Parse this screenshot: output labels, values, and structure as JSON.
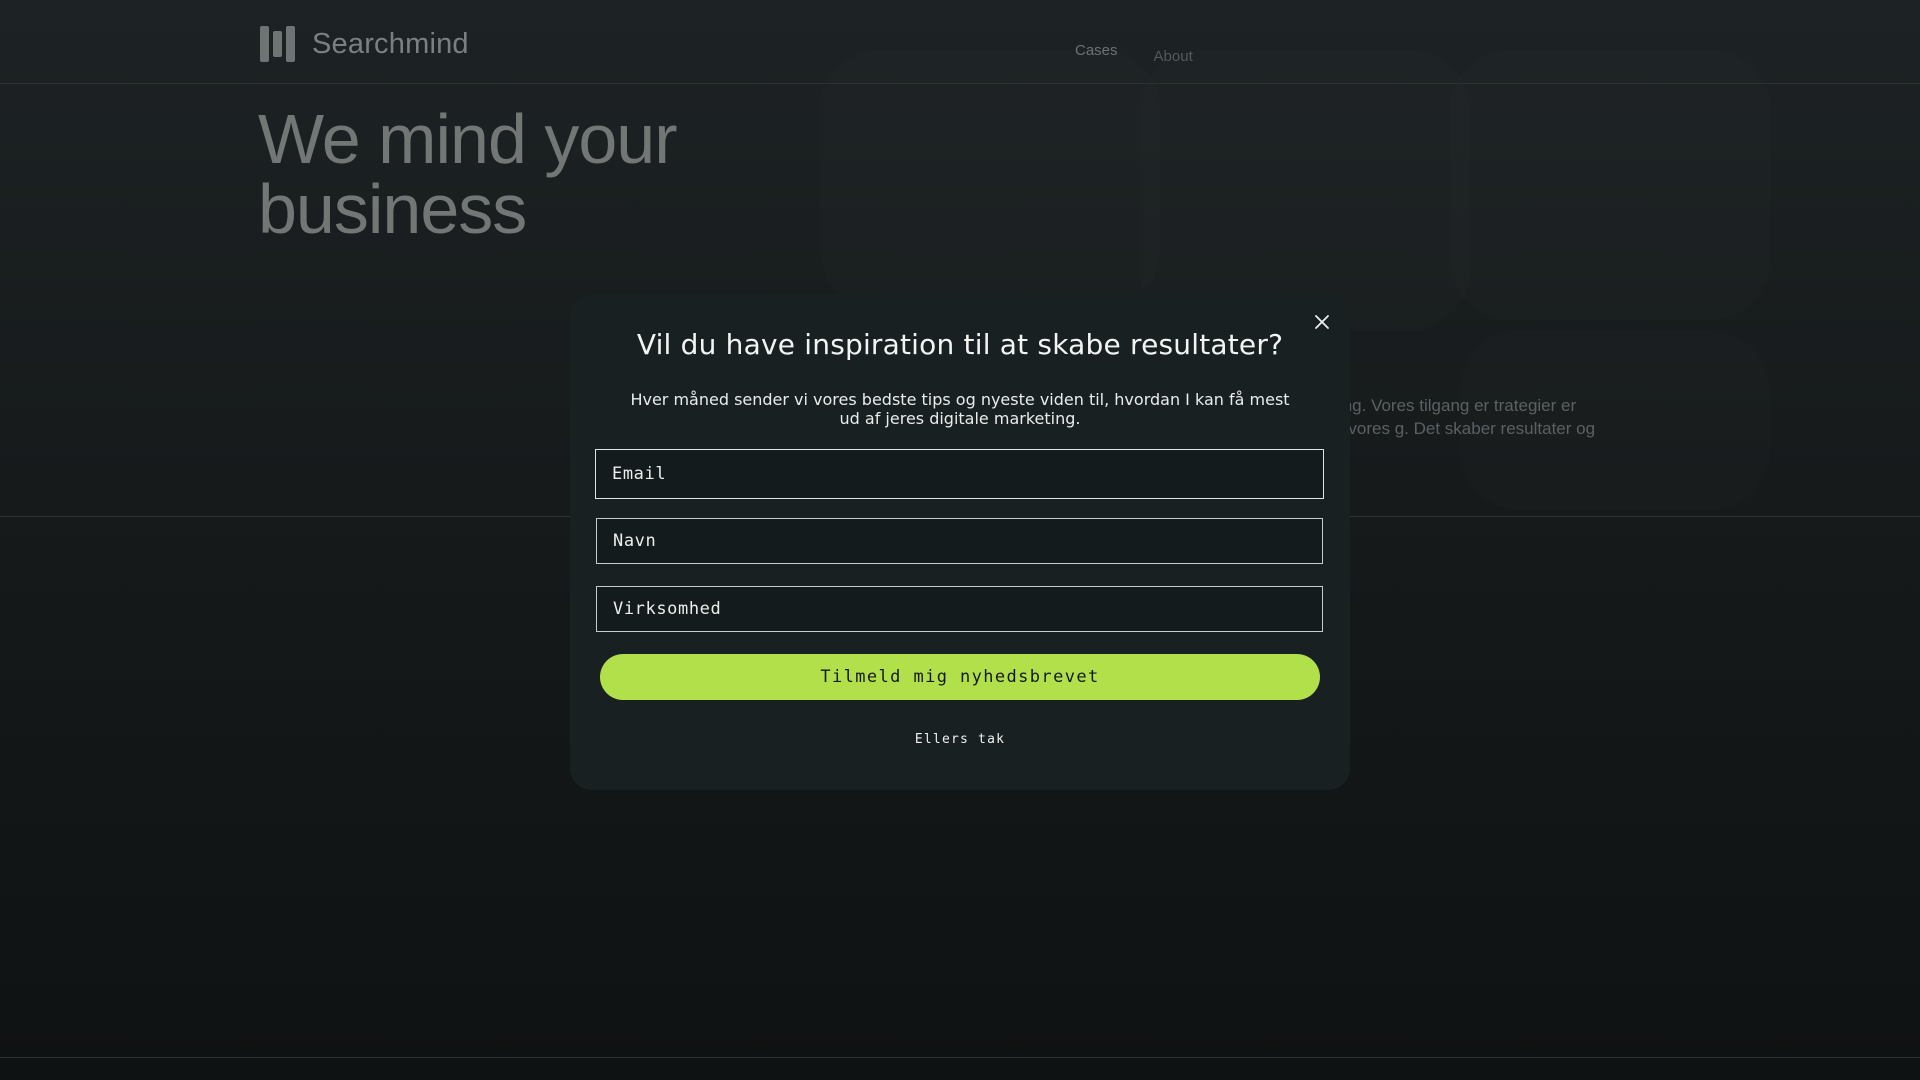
{
  "header": {
    "brand": "Searchmind",
    "nav": [
      {
        "label": "Cases"
      },
      {
        "label": "About"
      }
    ]
  },
  "hero": {
    "title_line1": "We mind your",
    "title_line2": "business",
    "paragraph_fragment": "stå din forretning. Vores tilgang er trategier er datadrevne og vores g. Det skaber resultater og vækst, der"
  },
  "modal": {
    "title": "Vil du have inspiration til at skabe resultater?",
    "subtitle": "Hver måned sender vi vores bedste tips og nyeste viden til, hvordan I kan få mest ud af jeres digitale marketing.",
    "fields": [
      {
        "placeholder": "Email"
      },
      {
        "placeholder": "Navn"
      },
      {
        "placeholder": "Virksomhed"
      }
    ],
    "submit_label": "Tilmeld mig nyhedsbrevet",
    "decline_label": "Ellers tak"
  },
  "colors": {
    "accent": "#b2e04b",
    "modal_bg": "#182022",
    "page_bg": "#161a1b"
  },
  "icons": {
    "close": "close-icon",
    "logo": "searchmind-logo-icon"
  }
}
